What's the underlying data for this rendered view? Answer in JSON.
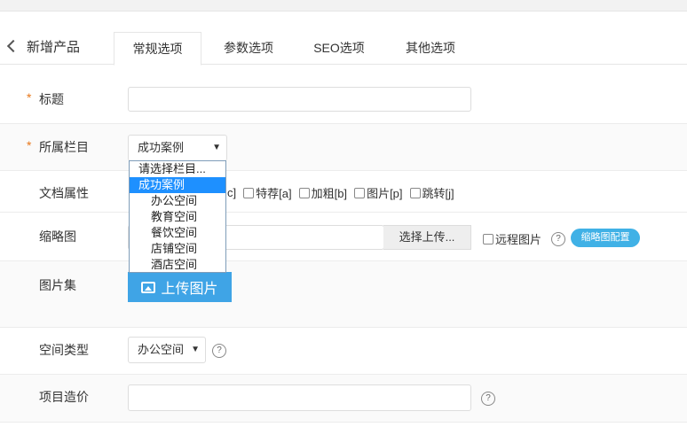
{
  "header": {
    "back_label": "新增产品",
    "tabs": [
      {
        "label": "常规选项"
      },
      {
        "label": "参数选项"
      },
      {
        "label": "SEO选项"
      },
      {
        "label": "其他选项"
      }
    ]
  },
  "form": {
    "required_mark": "*",
    "title_label": "标题",
    "title_value": "",
    "category_label": "所属栏目",
    "category_value": "成功案例",
    "category_options": [
      "请选择栏目...",
      "成功案例",
      "办公空间",
      "教育空间",
      "餐饮空间",
      "店铺空间",
      "酒店空间"
    ],
    "attr_label": "文档属性",
    "attr_partial": "c]",
    "attrs": [
      "特荐[a]",
      "加粗[b]",
      "图片[p]",
      "跳转[j]"
    ],
    "thumb_label": "缩略图",
    "thumb_choose": "选择上传...",
    "thumb_remote": "远程图片",
    "thumb_config": "缩略图配置",
    "gallery_label": "图片集",
    "gallery_upload": "上传图片",
    "space_type_label": "空间类型",
    "space_type_value": "办公空间",
    "cost_label": "项目造价",
    "cost_value": "",
    "help_glyph": "?",
    "dropdown_arrow": "▼"
  },
  "colors": {
    "accent": "#3fa4e6",
    "required": "#e8771a",
    "selected_option": "#1e90ff",
    "pill": "#40b1e6"
  }
}
